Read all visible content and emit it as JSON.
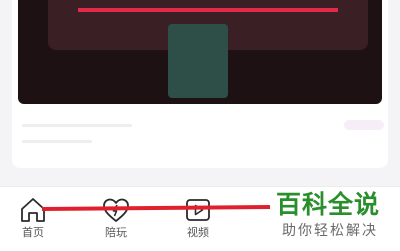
{
  "tabs": [
    {
      "label": "首页",
      "icon": "home-icon"
    },
    {
      "label": "陪玩",
      "icon": "heart-lightning-icon"
    },
    {
      "label": "视频",
      "icon": "video-play-icon"
    }
  ],
  "watermark": {
    "title": "百科全说",
    "subtitle": "助你轻松解决"
  },
  "colors": {
    "accent_red": "#e0202e",
    "watermark_green": "#2a8e2c",
    "thumbnail_dark": "#1e1114"
  }
}
